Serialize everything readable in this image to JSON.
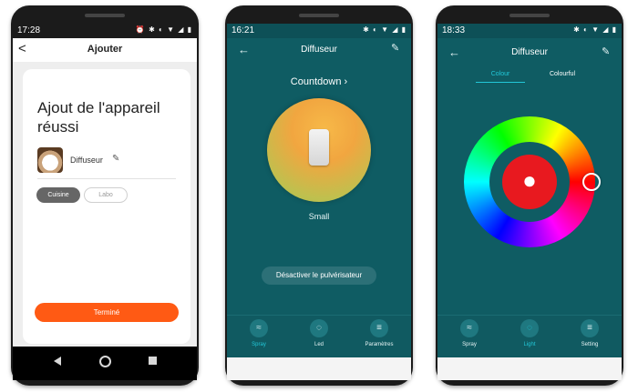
{
  "phones": [
    {
      "status": {
        "time": "17:28",
        "icons": "⏰ ✱ ◐ ▼ ◢ ▮"
      },
      "header": {
        "back_icon": "arrow-left-icon",
        "title": "Ajouter"
      },
      "card": {
        "heading": "Ajout de l'appareil réussi",
        "device_name": "Diffuseur",
        "rooms": [
          "Cuisine",
          "Labo"
        ],
        "selected_room": "Cuisine",
        "done_label": "Terminé"
      },
      "nav_icons": [
        "back-icon",
        "home-icon",
        "recents-icon"
      ],
      "colors": {
        "accent": "#ff5a14",
        "background": "#eeeeee"
      }
    },
    {
      "status": {
        "time": "16:21",
        "icons": "✱ ◐ ▼ ◢ ▮"
      },
      "header": {
        "back_icon": "arrow-left-icon",
        "title": "Diffuseur",
        "edit_icon": "pencil-icon"
      },
      "countdown_label": "Countdown",
      "mode_label": "Small",
      "spray_button_label": "Désactiver le pulvérisateur",
      "tabs": [
        {
          "label": "Spray",
          "icon": "spray-icon"
        },
        {
          "label": "Led",
          "icon": "bulb-icon"
        },
        {
          "label": "Paramètres",
          "icon": "settings-icon"
        }
      ],
      "colors": {
        "background": "#0f5c63",
        "accent": "#22c8d8"
      }
    },
    {
      "status": {
        "time": "18:33",
        "icons": "✱ ◐ ▼ ◢ ▮"
      },
      "header": {
        "back_icon": "arrow-left-icon",
        "title": "Diffuseur",
        "edit_icon": "pencil-icon"
      },
      "color_tabs": [
        "Colour",
        "Colourful"
      ],
      "active_color_tab": "Colour",
      "selected_color": "#e8191f",
      "tabs": [
        {
          "label": "Spray",
          "icon": "spray-icon"
        },
        {
          "label": "Light",
          "icon": "bulb-icon"
        },
        {
          "label": "Setting",
          "icon": "settings-icon"
        }
      ],
      "colors": {
        "background": "#0f5c63",
        "accent": "#22c8d8"
      }
    }
  ]
}
